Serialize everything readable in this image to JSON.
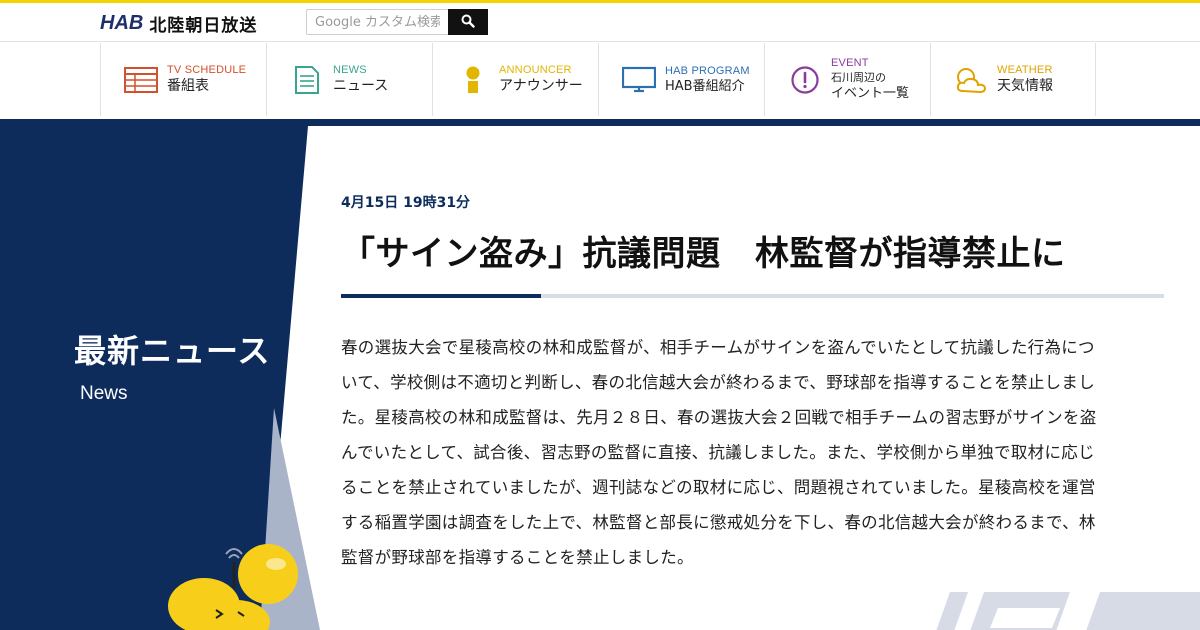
{
  "header": {
    "logo_mark": "HAB",
    "logo_text": "北陸朝日放送",
    "search": {
      "placeholder": "Google カスタム検索",
      "button_icon": "search-icon"
    }
  },
  "nav": {
    "items": [
      {
        "en": "TV SCHEDULE",
        "jp": "番組表",
        "icon": "tv-schedule-grid-icon",
        "color": "#d3512e"
      },
      {
        "en": "NEWS",
        "jp": "ニュース",
        "icon": "news-document-icon",
        "color": "#3aa58f"
      },
      {
        "en": "ANNOUNCER",
        "jp": "アナウンサー",
        "icon": "announcer-person-icon",
        "color": "#e2b600"
      },
      {
        "en": "HAB PROGRAM",
        "jp": "HAB番組紹介",
        "icon": "monitor-icon",
        "color": "#2d6fb3"
      },
      {
        "en": "EVENT",
        "jp_line1": "石川周辺の",
        "jp_line2": "イベント一覧",
        "icon": "exclamation-circle-icon",
        "color": "#8a3c9c"
      },
      {
        "en": "WEATHER",
        "jp": "天気情報",
        "icon": "weather-sun-cloud-icon",
        "color": "#e0a300"
      }
    ]
  },
  "sidebar": {
    "title": "最新ニュース",
    "subtitle": "News",
    "mascot": "mascot-character-icon"
  },
  "article": {
    "date": "4月15日 19時31分",
    "headline": "「サイン盗み」抗議問題　林監督が指導禁止に",
    "body": "春の選抜大会で星稜高校の林和成監督が、相手チームがサインを盗んでいたとして抗議した行為について、学校側は不適切と判断し、春の北信越大会が終わるまで、野球部を指導することを禁止しました。星稜高校の林和成監督は、先月２８日、春の選抜大会２回戦で相手チームの習志野がサインを盗んでいたとして、試合後、習志野の監督に直接、抗議しました。また、学校側から単独で取材に応じることを禁止されていましたが、週刊誌などの取材に応じ、問題視されていました。星稜高校を運営する稲置学園は調査をした上で、林監督と部長に懲戒処分を下し、春の北信越大会が終わるまで、林監督が野球部を指導することを禁止しました。"
  },
  "colors": {
    "navy": "#0d2c5c",
    "accent_yellow": "#f2d400",
    "rule_gray": "#d9dde4"
  }
}
